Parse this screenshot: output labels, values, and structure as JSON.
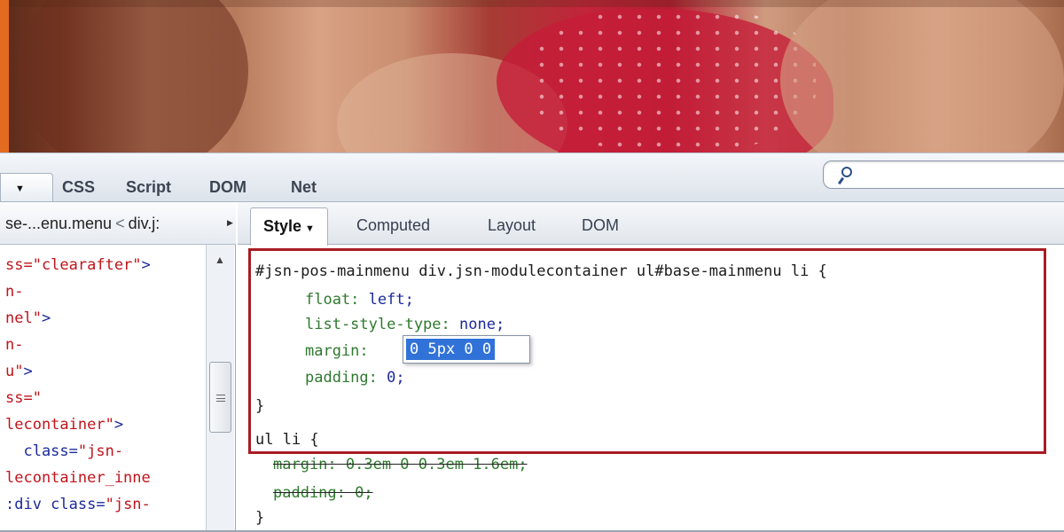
{
  "toolbar": {
    "tabs": [
      "CSS",
      "Script",
      "DOM",
      "Net"
    ],
    "search": {
      "value": "",
      "placeholder": ""
    }
  },
  "left_pane": {
    "breadcrumb": {
      "current": "se-...enu.menu",
      "separator": "<",
      "parent": "div.j:"
    },
    "lines": [
      {
        "pre": "",
        "str": "ss=\"clearafter\"",
        "post": ">"
      },
      {
        "pre": "",
        "str": "n-",
        "post": ""
      },
      {
        "pre": "",
        "str": "nel\"",
        "post": ">"
      },
      {
        "pre": "",
        "str": "n-",
        "post": ""
      },
      {
        "pre": "",
        "str": "u\"",
        "post": ">"
      },
      {
        "pre": "",
        "str": "ss=\"",
        "post": ""
      },
      {
        "pre": "",
        "str": "lecontainer\"",
        "post": ">"
      },
      {
        "pre": "  class=",
        "str": "\"jsn-",
        "post": ""
      },
      {
        "pre": "",
        "str": "lecontainer_inne",
        "post": ""
      },
      {
        "pre": ":div class=",
        "str": "\"jsn-",
        "post": ""
      }
    ]
  },
  "side_panel": {
    "tabs": {
      "style": "Style",
      "computed": "Computed",
      "layout": "Layout",
      "dom": "DOM"
    },
    "rule1": {
      "selector": "#jsn-pos-mainmenu div.jsn-modulecontainer ul#base-mainmenu li {",
      "float_prop": "float:",
      "float_val": "left;",
      "list_prop": "list-style-type:",
      "list_val": "none;",
      "margin_prop": "margin:",
      "margin_edit": "0 5px 0 0",
      "padding_prop": "padding:",
      "padding_val": "0;",
      "close": "}"
    },
    "rule2": {
      "selector": "ul li {",
      "margin": "margin: 0.3em 0 0.3em 1.6em;",
      "padding": "padding: 0;",
      "close": "}"
    }
  }
}
